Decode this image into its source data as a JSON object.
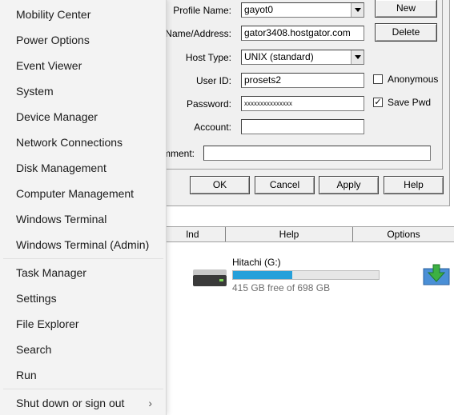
{
  "dialog": {
    "profile_name_label": "Profile Name:",
    "profile_name_value": "gayot0",
    "host_label": "t Name/Address:",
    "host_value": "gator3408.hostgator.com",
    "host_type_label": "Host Type:",
    "host_type_value": "UNIX (standard)",
    "user_id_label": "User ID:",
    "user_id_value": "prosets2",
    "password_label": "Password:",
    "password_value": "xxxxxxxxxxxxxxx",
    "account_label": "Account:",
    "account_value": "",
    "comment_label": "mment:",
    "comment_value": "",
    "anonymous_label": "Anonymous",
    "anonymous_checked": false,
    "save_pwd_label": "Save Pwd",
    "save_pwd_checked": true,
    "new_button": "New",
    "delete_button": "Delete",
    "ok_button": "OK",
    "cancel_button": "Cancel",
    "apply_button": "Apply",
    "help_button": "Help"
  },
  "bottom_bar": {
    "item1": "lnd",
    "help": "Help",
    "options": "Options"
  },
  "drive": {
    "name": "Hitachi (G:)",
    "free_text": "415 GB free of 698 GB",
    "used_fraction": 0.405,
    "bar_color": "#26a0da"
  },
  "menu": {
    "items": [
      {
        "label": "Mobility Center"
      },
      {
        "label": "Power Options"
      },
      {
        "label": "Event Viewer"
      },
      {
        "label": "System"
      },
      {
        "label": "Device Manager"
      },
      {
        "label": "Network Connections"
      },
      {
        "label": "Disk Management"
      },
      {
        "label": "Computer Management"
      },
      {
        "label": "Windows Terminal"
      },
      {
        "label": "Windows Terminal (Admin)"
      },
      {
        "label": "Task Manager"
      },
      {
        "label": "Settings"
      },
      {
        "label": "File Explorer"
      },
      {
        "label": "Search"
      },
      {
        "label": "Run"
      },
      {
        "label": "Shut down or sign out"
      }
    ]
  }
}
